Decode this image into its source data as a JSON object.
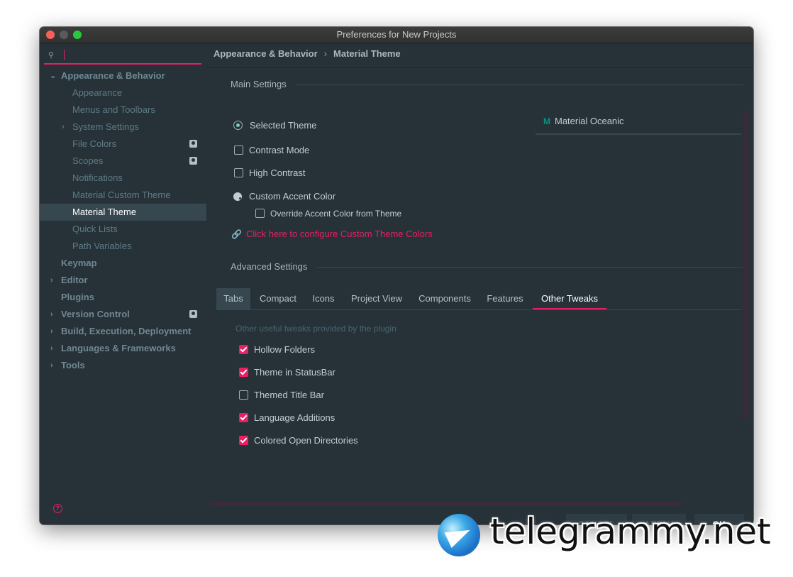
{
  "window": {
    "title": "Preferences for New Projects"
  },
  "sidebar": {
    "search": {
      "value": ""
    },
    "items": [
      {
        "label": "Appearance & Behavior"
      },
      {
        "label": "Appearance"
      },
      {
        "label": "Menus and Toolbars"
      },
      {
        "label": "System Settings"
      },
      {
        "label": "File Colors"
      },
      {
        "label": "Scopes"
      },
      {
        "label": "Notifications"
      },
      {
        "label": "Material Custom Theme"
      },
      {
        "label": "Material Theme"
      },
      {
        "label": "Quick Lists"
      },
      {
        "label": "Path Variables"
      },
      {
        "label": "Keymap"
      },
      {
        "label": "Editor"
      },
      {
        "label": "Plugins"
      },
      {
        "label": "Version Control"
      },
      {
        "label": "Build, Execution, Deployment"
      },
      {
        "label": "Languages & Frameworks"
      },
      {
        "label": "Tools"
      }
    ],
    "help": "?"
  },
  "breadcrumb": {
    "parent": "Appearance & Behavior",
    "sep": "›",
    "current": "Material Theme"
  },
  "main_settings": {
    "title": "Main Settings",
    "selected_theme": "Selected Theme",
    "theme_value": "Material Oceanic",
    "theme_icon_glyph": "M",
    "contrast_mode": "Contrast Mode",
    "high_contrast": "High Contrast",
    "custom_accent": "Custom Accent Color",
    "override_accent": "Override Accent Color from Theme",
    "configure_link": "Click here to configure Custom Theme Colors"
  },
  "advanced_settings": {
    "title": "Advanced Settings",
    "tabs": [
      {
        "label": "Tabs"
      },
      {
        "label": "Compact"
      },
      {
        "label": "Icons"
      },
      {
        "label": "Project View"
      },
      {
        "label": "Components"
      },
      {
        "label": "Features"
      },
      {
        "label": "Other Tweaks"
      }
    ],
    "hint": "Other useful tweaks provided by the plugin",
    "tweaks": [
      {
        "label": "Hollow Folders",
        "checked": true
      },
      {
        "label": "Theme in StatusBar",
        "checked": true
      },
      {
        "label": "Themed Title Bar",
        "checked": false
      },
      {
        "label": "Language Additions",
        "checked": true
      },
      {
        "label": "Colored Open Directories",
        "checked": true
      }
    ]
  },
  "buttons": {
    "cancel": "CANCEL",
    "apply": "APPLY",
    "ok": "OK"
  },
  "watermark": {
    "text": "telegrammy.net"
  },
  "colors": {
    "accent": "#e91e63",
    "background": "#263238",
    "selection": "#37474f",
    "teal": "#009688"
  }
}
